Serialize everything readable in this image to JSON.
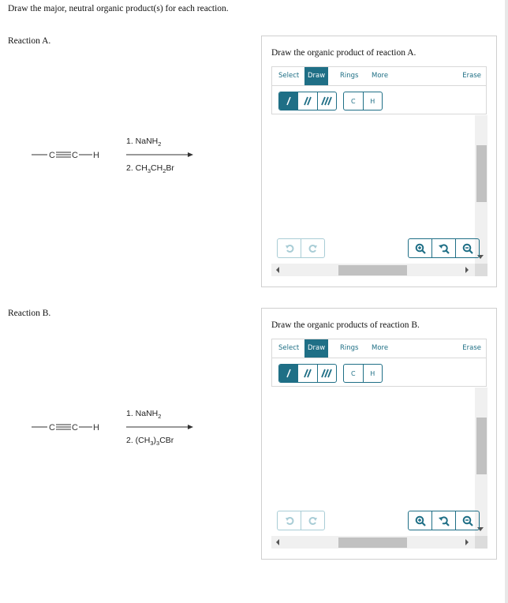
{
  "instructions": "Draw the major, neutral organic product(s) for each reaction.",
  "reactions": [
    {
      "label": "Reaction A.",
      "reactant": {
        "left_bond": "—",
        "atom1": "C",
        "atom2": "C",
        "atom3": "H"
      },
      "reagent1": {
        "pre": "1. NaNH",
        "sub": "2",
        "post": ""
      },
      "reagent2_parts": [
        "2. CH",
        "3",
        "CH",
        "2",
        "Br"
      ],
      "panel": {
        "title": "Draw the organic product of reaction A.",
        "tabs": [
          "Select",
          "Draw",
          "Rings",
          "More"
        ],
        "active_tab": "Draw",
        "erase": "Erase",
        "bond_tools": [
          "single-bond",
          "double-bond",
          "triple-bond"
        ],
        "atom_tools": [
          "C",
          "H"
        ]
      }
    },
    {
      "label": "Reaction B.",
      "reactant": {
        "left_bond": "—",
        "atom1": "C",
        "atom2": "C",
        "atom3": "H"
      },
      "reagent1": {
        "pre": "1. NaNH",
        "sub": "2",
        "post": ""
      },
      "reagent2_parts": [
        "2. (CH",
        "3",
        ")",
        "3",
        "CBr"
      ],
      "panel": {
        "title": "Draw the organic products of reaction B.",
        "tabs": [
          "Select",
          "Draw",
          "Rings",
          "More"
        ],
        "active_tab": "Draw",
        "erase": "Erase",
        "bond_tools": [
          "single-bond",
          "double-bond",
          "triple-bond"
        ],
        "atom_tools": [
          "C",
          "H"
        ]
      }
    }
  ],
  "colors": {
    "accent": "#1f6f86",
    "disabled": "#a9cdd6",
    "scroll_track": "#f0f0f0",
    "scroll_thumb": "#c1c1c1"
  }
}
